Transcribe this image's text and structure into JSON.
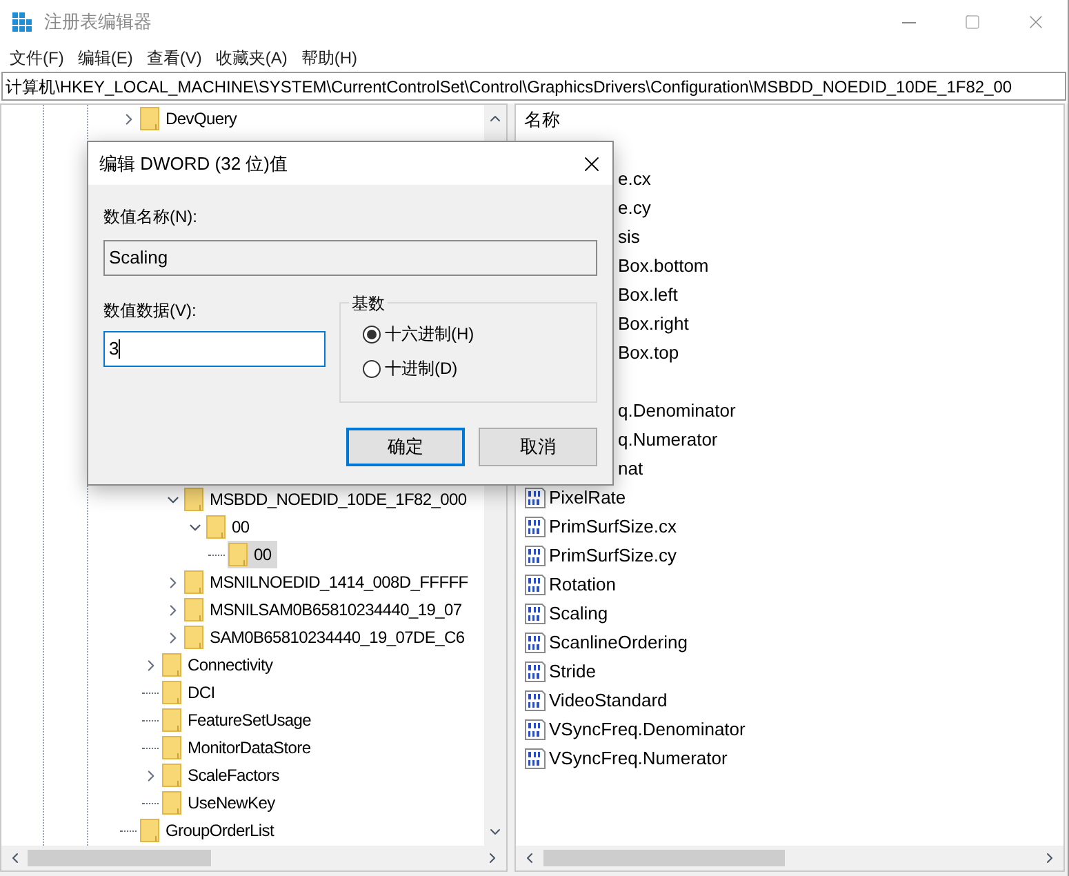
{
  "window": {
    "title": "注册表编辑器"
  },
  "menu": [
    "文件(F)",
    "编辑(E)",
    "查看(V)",
    "收藏夹(A)",
    "帮助(H)"
  ],
  "address": "计算机\\HKEY_LOCAL_MACHINE\\SYSTEM\\CurrentControlSet\\Control\\GraphicsDrivers\\Configuration\\MSBDD_NOEDID_10DE_1F82_00",
  "tree": [
    {
      "label": "DevQuery",
      "kind": "branch",
      "expanded": false,
      "selected": false
    },
    {
      "children": [
        {
          "children": [
            {
              "label": "MSBDD_NOEDID_10DE_1F82_000",
              "kind": "branch",
              "expanded": true,
              "selected": false,
              "children": [
                {
                  "label": "00",
                  "kind": "branch",
                  "expanded": true,
                  "selected": false,
                  "children": [
                    {
                      "label": "00",
                      "kind": "leaf",
                      "selected": true
                    }
                  ]
                }
              ]
            },
            {
              "label": "MSNILNOEDID_1414_008D_FFFFF",
              "kind": "branch",
              "expanded": false,
              "selected": false
            },
            {
              "label": "MSNILSAM0B65810234440_19_07",
              "kind": "branch",
              "expanded": false,
              "selected": false
            },
            {
              "label": "SAM0B65810234440_19_07DE_C6",
              "kind": "branch",
              "expanded": false,
              "selected": false
            }
          ]
        },
        {
          "label": "Connectivity",
          "kind": "branch",
          "expanded": false,
          "selected": false
        },
        {
          "label": "DCI",
          "kind": "leaf",
          "selected": false
        },
        {
          "label": "FeatureSetUsage",
          "kind": "leaf",
          "selected": false
        },
        {
          "label": "MonitorDataStore",
          "kind": "leaf",
          "selected": false
        },
        {
          "label": "ScaleFactors",
          "kind": "branch",
          "expanded": false,
          "selected": false
        },
        {
          "label": "UseNewKey",
          "kind": "leaf",
          "selected": false
        }
      ]
    },
    {
      "label": "GroupOrderList",
      "kind": "leaf",
      "selected": false
    }
  ],
  "values": {
    "column": "名称",
    "rows": [
      {
        "kind": "covered"
      },
      {
        "kind": "partial",
        "name": "e.cx"
      },
      {
        "kind": "partial",
        "name": "e.cy"
      },
      {
        "kind": "partial",
        "name": "sis"
      },
      {
        "kind": "partial",
        "name": "Box.bottom"
      },
      {
        "kind": "partial",
        "name": "Box.left"
      },
      {
        "kind": "partial",
        "name": "Box.right"
      },
      {
        "kind": "partial",
        "name": "Box.top"
      },
      {
        "kind": "covered"
      },
      {
        "kind": "partial",
        "name": "q.Denominator"
      },
      {
        "kind": "partial",
        "name": "q.Numerator"
      },
      {
        "kind": "partial",
        "name": "nat"
      },
      {
        "kind": "value",
        "name": "PixelRate"
      },
      {
        "kind": "value",
        "name": "PrimSurfSize.cx"
      },
      {
        "kind": "value",
        "name": "PrimSurfSize.cy"
      },
      {
        "kind": "value",
        "name": "Rotation"
      },
      {
        "kind": "value",
        "name": "Scaling"
      },
      {
        "kind": "value",
        "name": "ScanlineOrdering"
      },
      {
        "kind": "value",
        "name": "Stride"
      },
      {
        "kind": "value",
        "name": "VideoStandard"
      },
      {
        "kind": "value",
        "name": "VSyncFreq.Denominator"
      },
      {
        "kind": "value",
        "name": "VSyncFreq.Numerator"
      }
    ]
  },
  "dialog": {
    "title": "编辑 DWORD (32 位)值",
    "name_label": "数值名称(N):",
    "name_value": "Scaling",
    "data_label": "数值数据(V):",
    "data_value": "3",
    "base": {
      "label": "基数",
      "options": [
        {
          "label": "十六进制(H)",
          "selected": true
        },
        {
          "label": "十进制(D)",
          "selected": false
        }
      ]
    },
    "buttons": [
      {
        "label": "确定",
        "default": true
      },
      {
        "label": "取消",
        "default": false
      }
    ]
  }
}
